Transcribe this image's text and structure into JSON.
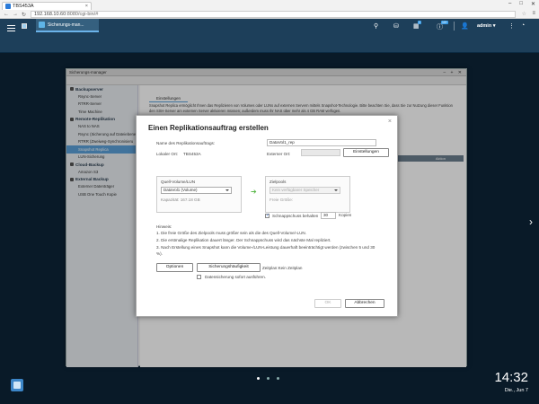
{
  "browser": {
    "tab_title": "TBS453A",
    "url_host": "192.168.10.60",
    "url_rest": ":8080/cgi-bin/#",
    "win_min": "–",
    "win_max": "□",
    "win_close": "✕"
  },
  "qts": {
    "app_tab_label": "Sicherungs-man...",
    "badge_one": "1",
    "badge_two": "10+",
    "user": "admin",
    "user_caret": "▾"
  },
  "sm": {
    "title": "Sicherungs-manager",
    "controls": "– + ✕",
    "sidebar": [
      {
        "type": "cat",
        "label": "Backupserver"
      },
      {
        "type": "item",
        "label": "Rsync-Server"
      },
      {
        "type": "item",
        "label": "RTRR-Server"
      },
      {
        "type": "item",
        "label": "Time Machine"
      },
      {
        "type": "cat",
        "label": "Remote-Replikation"
      },
      {
        "type": "item",
        "label": "NAS to NAS"
      },
      {
        "type": "item",
        "label": "Rsync (Sicherung auf Dateiebene)"
      },
      {
        "type": "item",
        "label": "RTRR (Zweiweg-Synchronisieru"
      },
      {
        "type": "item",
        "label": "Snapshot Replica",
        "selected": true
      },
      {
        "type": "item",
        "label": "LUN-Sicherung"
      },
      {
        "type": "cat",
        "label": "Cloud-Backup"
      },
      {
        "type": "item",
        "label": "Amazon S3"
      },
      {
        "type": "cat",
        "label": "External Backup"
      },
      {
        "type": "item",
        "label": "Externer Datenträger"
      },
      {
        "type": "item",
        "label": "USB One Touch Kopie"
      }
    ],
    "tab": "Einstellungen",
    "desc": "Snapshot Replica ermöglicht Ihnen das Replizieren von Volumes oder LUNs auf externen Servern mittels Snapshot-Technologie. Bitte beachten Sie, dass Sie zur Nutzung dieser Funktion den SSH-Server am externen Server aktivieren müssen; außerdem muss Ihr NAS über mehr als 4 GB RAM verfügen.",
    "table_action": "Aktion"
  },
  "dialog": {
    "title": "Einen Replikationsauftrag erstellen",
    "close": "×",
    "job_name_label": "Name des Replikationsauftrags:",
    "job_name_value": "DataVol1_rep",
    "local_label": "Lokaler Ort:",
    "local_value": "TBS453A",
    "remote_label": "Externer Ort:",
    "settings_button": "Einstellungen",
    "source_label": "Quell-Volume/LUN",
    "source_value": "DataVol1 (Volume)",
    "capacity": "Kapazität: 167.18 GB",
    "target_label": "Zielpools",
    "target_placeholder": "Kein verfügbarer Speicher",
    "free_size": "Freie Größe:",
    "arrow": "➔",
    "keep_label": "Schnappschuss behalten",
    "keep_value": "30",
    "copies": "Kopien",
    "hints_title": "Hinweis:",
    "hints": [
      "1. Die freie Größe des Zielpools muss größer sein als die des Quell-Volume/-LUN.",
      "2. Die erstmalige Replikation dauert länger. Der Schnappschuss wird das nächste Mal repliziert.",
      "3. Nach Erstellung eines Snapshot kann die Volume-/LUN-Leistung dauerhaft beeinträchtigt werden (zwischen 5 und 30",
      "%)."
    ],
    "options_button": "Optionen",
    "frequency_button": "Sicherungshäufigkeit",
    "schedule_text": "Zeitplan:Kein Zeitplan",
    "immediate_label": "Datensicherung sofort ausführen.",
    "ok_button": "OK",
    "cancel_button": "Abbrechen"
  },
  "desktop": {
    "time": "14:32",
    "date": "Die., Jun 7"
  },
  "colors": {
    "qts_bar": "#1d3f5a",
    "accent": "#5aa0d8",
    "desktop_bg": "#0d2438"
  }
}
